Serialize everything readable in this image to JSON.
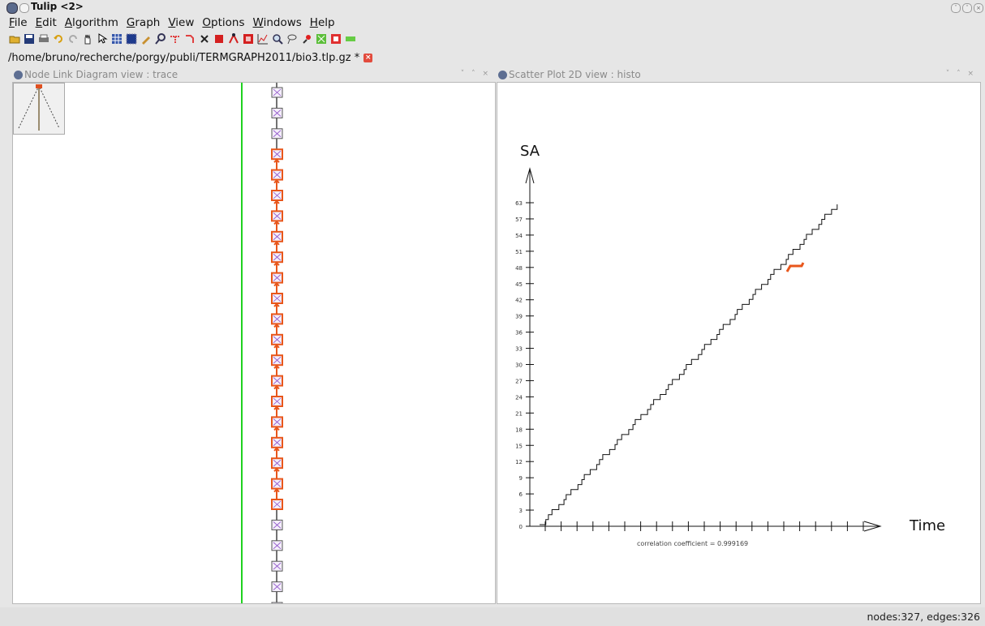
{
  "window": {
    "title": "Tulip <2>"
  },
  "menu": [
    "File",
    "Edit",
    "Algorithm",
    "Graph",
    "View",
    "Options",
    "Windows",
    "Help"
  ],
  "toolbar_icons": [
    "open-folder-icon",
    "save-icon",
    "print-icon",
    "undo-icon",
    "redo-icon",
    "hand-icon",
    "pointer-icon",
    "grid-icon",
    "select-rect-icon",
    "brush-icon",
    "magnify-icon",
    "edge-select-icon",
    "bend-icon",
    "delete-icon",
    "cube-icon",
    "add-edge-icon",
    "red-square-icon",
    "chart-icon",
    "zoom-icon",
    "lasso-icon",
    "pin-icon",
    "green-graph-icon",
    "red-target-icon",
    "green-bar-icon"
  ],
  "document_tab": {
    "path": "/home/bruno/recherche/porgy/publi/TERMGRAPH2011/bio3.tlp.gz *"
  },
  "left_view": {
    "title": "Node Link Diagram view : trace"
  },
  "right_view": {
    "title": "Scatter Plot 2D view : histo"
  },
  "scatter": {
    "y_axis_label": "SA",
    "x_axis_label": "Time",
    "y_ticks": [
      "0",
      "3",
      "6",
      "9",
      "12",
      "15",
      "18",
      "21",
      "24",
      "27",
      "30",
      "33",
      "36",
      "39",
      "42",
      "45",
      "48",
      "51",
      "54",
      "57",
      "63"
    ],
    "correlation_text": "correlation coefficient = 0.999169",
    "highlight_color": "#e8561b"
  },
  "status": {
    "text": "nodes:327, edges:326"
  }
}
